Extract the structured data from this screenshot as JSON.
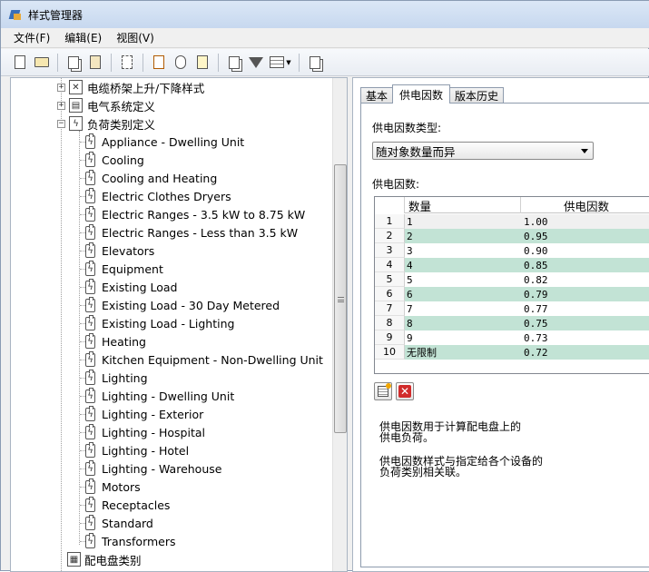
{
  "window": {
    "title": "样式管理器"
  },
  "menu": [
    {
      "label": "文件(F)"
    },
    {
      "label": "编辑(E)"
    },
    {
      "label": "视图(V)"
    }
  ],
  "tree": {
    "parents": [
      {
        "label": "电缆桥架上升/下降样式",
        "expander": "+"
      },
      {
        "label": "电气系统定义",
        "expander": "+"
      },
      {
        "label": "负荷类别定义",
        "expander": "−"
      }
    ],
    "children": [
      "Appliance - Dwelling Unit",
      "Cooling",
      "Cooling and Heating",
      "Electric Clothes Dryers",
      "Electric Ranges - 3.5 kW to 8.75 kW",
      "Electric Ranges - Less than 3.5 kW",
      "Elevators",
      "Equipment",
      "Existing Load",
      "Existing Load - 30 Day Metered",
      "Existing Load - Lighting",
      "Heating",
      "Kitchen Equipment - Non-Dwelling Unit",
      "Lighting",
      "Lighting - Dwelling Unit",
      "Lighting - Exterior",
      "Lighting - Hospital",
      "Lighting - Hotel",
      "Lighting - Warehouse",
      "Motors",
      "Receptacles",
      "Standard",
      "Transformers"
    ],
    "last": {
      "label": "配电盘类别"
    }
  },
  "tabs": [
    {
      "label": "基本"
    },
    {
      "label": "供电因数"
    },
    {
      "label": "版本历史"
    }
  ],
  "panel": {
    "type_label": "供电因数类型:",
    "type_value": "随对象数量而异",
    "factor_label": "供电因数:",
    "columns": [
      "数量",
      "供电因数"
    ],
    "rows": [
      {
        "n": "1",
        "qty": "1",
        "factor": "1.00"
      },
      {
        "n": "2",
        "qty": "2",
        "factor": "0.95"
      },
      {
        "n": "3",
        "qty": "3",
        "factor": "0.90"
      },
      {
        "n": "4",
        "qty": "4",
        "factor": "0.85"
      },
      {
        "n": "5",
        "qty": "5",
        "factor": "0.82"
      },
      {
        "n": "6",
        "qty": "6",
        "factor": "0.79"
      },
      {
        "n": "7",
        "qty": "7",
        "factor": "0.77"
      },
      {
        "n": "8",
        "qty": "8",
        "factor": "0.75"
      },
      {
        "n": "9",
        "qty": "9",
        "factor": "0.73"
      },
      {
        "n": "10",
        "qty": "无限制",
        "factor": "0.72"
      }
    ],
    "desc1_line1": "供电因数用于计算配电盘上的",
    "desc1_line2": "供电负荷。",
    "desc2_line1": "供电因数样式与指定给各个设备的",
    "desc2_line2": "负荷类别相关联。"
  },
  "colors": {
    "alt_row": "#c2e3d5",
    "title_bar": "#c7d8ef"
  },
  "icons": [
    "new-icon",
    "open-icon",
    "copy-icon",
    "paste-icon",
    "filter-icon",
    "grid-view-icon",
    "delete-icon",
    "add-row-icon"
  ]
}
